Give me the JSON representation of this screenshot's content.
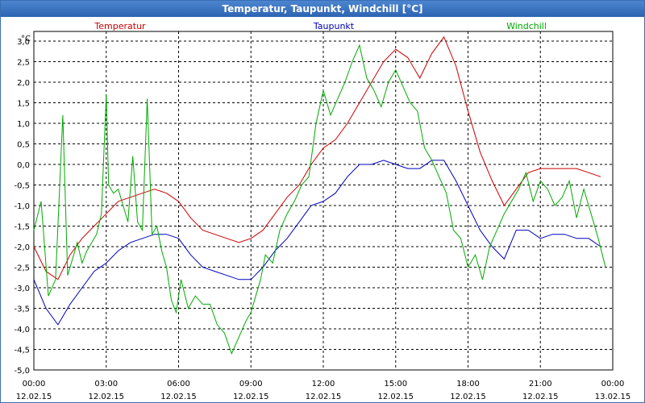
{
  "window": {
    "title": "Temperatur, Taupunkt, Windchill [°C]"
  },
  "chart_data": {
    "type": "line",
    "title": "Temperatur, Taupunkt, Windchill [°C]",
    "ylabel": "°C",
    "ylim": [
      -5.0,
      3.0
    ],
    "yticks": [
      "3,0",
      "2,5",
      "2,0",
      "1,5",
      "1,0",
      "0,5",
      "0,0",
      "-0,5",
      "-1,0",
      "-1,5",
      "-2,0",
      "-2,5",
      "-3,0",
      "-3,5",
      "-4,0",
      "-4,5",
      "-5,0"
    ],
    "xticks": [
      {
        "time": "00:00",
        "date": "12.02.15"
      },
      {
        "time": "03:00",
        "date": "12.02.15"
      },
      {
        "time": "06:00",
        "date": "12.02.15"
      },
      {
        "time": "09:00",
        "date": "12.02.15"
      },
      {
        "time": "12:00",
        "date": "12.02.15"
      },
      {
        "time": "15:00",
        "date": "12.02.15"
      },
      {
        "time": "18:00",
        "date": "12.02.15"
      },
      {
        "time": "21:00",
        "date": "12.02.15"
      },
      {
        "time": "00:00",
        "date": "13.02.15"
      }
    ],
    "grid": true,
    "legend": "top",
    "x_unit": "hours",
    "series": [
      {
        "name": "Temperatur",
        "color": "#cc0000",
        "x": [
          0,
          0.5,
          1,
          1.5,
          2,
          2.5,
          3,
          3.5,
          4,
          4.5,
          5,
          5.5,
          6,
          6.5,
          7,
          7.5,
          8,
          8.5,
          9,
          9.5,
          10,
          10.5,
          11,
          11.5,
          12,
          12.5,
          13,
          13.5,
          14,
          14.5,
          15,
          15.5,
          16,
          16.5,
          17,
          17.5,
          18,
          18.5,
          19,
          19.5,
          20,
          20.5,
          21,
          21.5,
          22,
          22.5,
          23,
          23.5
        ],
        "y": [
          -2.0,
          -2.6,
          -2.8,
          -2.2,
          -1.8,
          -1.5,
          -1.2,
          -0.9,
          -0.8,
          -0.7,
          -0.6,
          -0.7,
          -0.9,
          -1.3,
          -1.6,
          -1.7,
          -1.8,
          -1.9,
          -1.8,
          -1.6,
          -1.2,
          -0.8,
          -0.5,
          0.0,
          0.4,
          0.6,
          1.0,
          1.5,
          2.0,
          2.5,
          2.8,
          2.6,
          2.1,
          2.7,
          3.1,
          2.4,
          1.3,
          0.3,
          -0.4,
          -1.0,
          -0.6,
          -0.2,
          -0.1,
          -0.1,
          -0.1,
          -0.1,
          -0.2,
          -0.3
        ]
      },
      {
        "name": "Taupunkt",
        "color": "#0000bb",
        "x": [
          0,
          0.5,
          1,
          1.5,
          2,
          2.5,
          3,
          3.5,
          4,
          4.5,
          5,
          5.5,
          6,
          6.5,
          7,
          7.5,
          8,
          8.5,
          9,
          9.5,
          10,
          10.5,
          11,
          11.5,
          12,
          12.5,
          13,
          13.5,
          14,
          14.5,
          15,
          15.5,
          16,
          16.5,
          17,
          17.5,
          18,
          18.5,
          19,
          19.5,
          20,
          20.5,
          21,
          21.5,
          22,
          22.5,
          23,
          23.5
        ],
        "y": [
          -2.8,
          -3.5,
          -3.9,
          -3.4,
          -3.0,
          -2.6,
          -2.4,
          -2.1,
          -1.9,
          -1.8,
          -1.7,
          -1.7,
          -1.8,
          -2.2,
          -2.5,
          -2.6,
          -2.7,
          -2.8,
          -2.8,
          -2.5,
          -2.1,
          -1.8,
          -1.4,
          -1.0,
          -0.9,
          -0.7,
          -0.3,
          0.0,
          0.0,
          0.1,
          0.0,
          -0.1,
          -0.1,
          0.1,
          0.1,
          -0.4,
          -1.0,
          -1.6,
          -2.0,
          -2.3,
          -1.6,
          -1.6,
          -1.8,
          -1.7,
          -1.7,
          -1.8,
          -1.8,
          -2.0
        ]
      },
      {
        "name": "Windchill",
        "color": "#00aa00",
        "x": [
          0,
          0.3,
          0.6,
          0.9,
          1.2,
          1.4,
          1.6,
          1.8,
          2.0,
          2.2,
          2.4,
          2.6,
          2.8,
          3.0,
          3.1,
          3.3,
          3.5,
          3.7,
          3.9,
          4.1,
          4.3,
          4.5,
          4.7,
          4.9,
          5.1,
          5.3,
          5.5,
          5.7,
          5.9,
          6.1,
          6.4,
          6.7,
          7.0,
          7.3,
          7.6,
          7.9,
          8.2,
          8.5,
          8.8,
          9.0,
          9.2,
          9.4,
          9.6,
          9.9,
          10.2,
          10.5,
          10.8,
          11.1,
          11.4,
          11.7,
          12.0,
          12.3,
          12.6,
          12.9,
          13.2,
          13.5,
          13.8,
          14.1,
          14.4,
          14.7,
          15.0,
          15.3,
          15.6,
          15.9,
          16.2,
          16.5,
          16.8,
          17.1,
          17.4,
          17.7,
          18.0,
          18.3,
          18.6,
          18.9,
          19.2,
          19.5,
          19.8,
          20.1,
          20.4,
          20.7,
          21.0,
          21.3,
          21.6,
          21.9,
          22.2,
          22.5,
          22.8,
          23.1,
          23.4,
          23.7
        ],
        "y": [
          -1.6,
          -0.9,
          -3.2,
          -2.8,
          1.2,
          -2.7,
          -2.3,
          -1.9,
          -2.4,
          -2.1,
          -1.9,
          -1.7,
          -1.2,
          1.7,
          -0.5,
          -0.7,
          -0.6,
          -1.0,
          -1.4,
          0.2,
          -1.4,
          -1.6,
          1.6,
          -1.7,
          -1.5,
          -2.1,
          -2.5,
          -3.3,
          -3.6,
          -2.8,
          -3.5,
          -3.2,
          -3.4,
          -3.4,
          -3.9,
          -4.1,
          -4.6,
          -4.2,
          -3.8,
          -3.6,
          -3.2,
          -2.8,
          -2.2,
          -2.4,
          -1.6,
          -1.2,
          -0.9,
          -0.5,
          -0.3,
          1.0,
          1.8,
          1.2,
          1.6,
          2.0,
          2.5,
          2.9,
          2.1,
          1.8,
          1.4,
          2.0,
          2.3,
          1.9,
          1.5,
          1.3,
          0.4,
          0.1,
          -0.3,
          -0.7,
          -1.6,
          -1.8,
          -2.5,
          -2.2,
          -2.8,
          -2.0,
          -1.6,
          -1.2,
          -0.9,
          -0.6,
          -0.2,
          -0.9,
          -0.4,
          -0.6,
          -1.0,
          -0.8,
          -0.4,
          -1.3,
          -0.6,
          -1.2,
          -1.8,
          -2.5
        ]
      }
    ]
  }
}
